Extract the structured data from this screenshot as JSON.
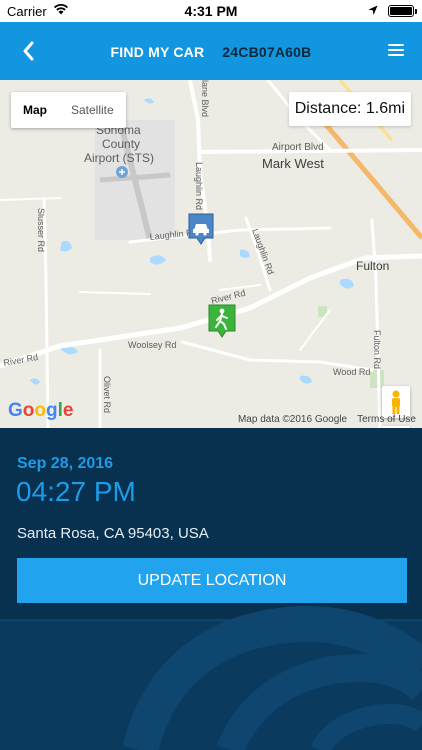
{
  "status_bar": {
    "carrier": "Carrier",
    "time": "4:31 PM"
  },
  "nav": {
    "title": "FIND MY CAR",
    "plate": "24CB07A60B"
  },
  "map": {
    "map_type_options": [
      "Map",
      "Satellite"
    ],
    "selected_map_type": "Map",
    "distance": "Distance: 1.6mi",
    "labels": {
      "airport": [
        "Sonoma",
        "County",
        "Airport (STS)"
      ],
      "airport_blvd": "Airport Blvd",
      "mark_west": "Mark West",
      "fulton": "Fulton",
      "laughlin_rd_1": "Laughlin Rd",
      "laughlin_rd_2": "Laughlin Rd",
      "laughlin_rd_3": "Laughlin Rd",
      "river_rd_1": "River Rd",
      "river_rd_2": "River Rd",
      "woolsey_rd": "Woolsey Rd",
      "wood_rd": "Wood Rd",
      "slusser_rd": "Slusser Rd",
      "olivet_rd": "Olivet Rd",
      "fulton_rd": "Fulton Rd",
      "blvd_partial": "lane Blvd"
    },
    "zoom_in": "+",
    "zoom_out": "−",
    "google_logo": "Google",
    "attribution": "Map data ©2016 Google",
    "terms": "Terms of Use"
  },
  "record": {
    "date": "Sep 28, 2016",
    "time": "04:27 PM",
    "address": "Santa Rosa, CA 95403, USA",
    "update_button": "UPDATE LOCATION"
  },
  "colors": {
    "nav_bg": "#1396e0",
    "panel_bg": "#08304f",
    "accent": "#1e9be6",
    "button_bg": "#22a3ee"
  },
  "icons": {
    "back": "chevron-left-icon",
    "menu": "hamburger-menu-icon",
    "car_marker": "car-marker-icon",
    "walk_marker": "pedestrian-marker-icon",
    "pegman": "pegman-icon"
  }
}
